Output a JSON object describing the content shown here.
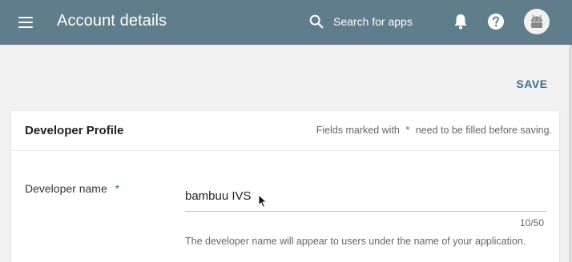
{
  "header": {
    "title": "Account details",
    "search_placeholder": "Search for apps",
    "menu_icon": "menu-icon",
    "search_icon": "search-icon",
    "bell_icon": "bell-icon",
    "help_icon": "help-icon",
    "avatar_icon": "android-avatar-icon",
    "bg_color": "#607d8b"
  },
  "actions": {
    "save_label": "SAVE",
    "accent_color": "#3d6e8c"
  },
  "card": {
    "title": "Developer Profile",
    "note_prefix": "Fields marked with",
    "note_star": "*",
    "note_suffix": "need to be filled before saving.",
    "developer_name": {
      "label": "Developer name",
      "required_star": "*",
      "value": "bambuu IVS",
      "char_count": "10/50",
      "helper": "The developer name will appear to users under the name of your application."
    }
  }
}
